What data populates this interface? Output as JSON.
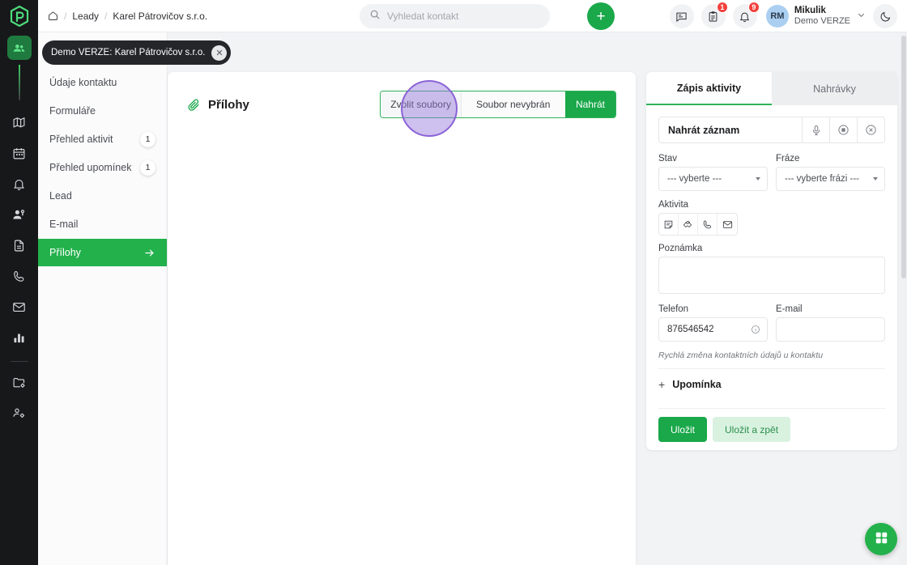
{
  "app": {
    "logo_icon": "hexagon-r-logo",
    "accent_green": "#1aa84a",
    "active_green": "#23b14c",
    "dark_rail": "#17181a",
    "cursor_highlight": "#8b63d6"
  },
  "rail": {
    "items": [
      {
        "icon": "contacts-icon",
        "name": "contacts",
        "active": true
      },
      {
        "icon": "map-icon",
        "name": "map",
        "active": false
      },
      {
        "icon": "calendar-icon",
        "name": "calendar",
        "active": false
      },
      {
        "icon": "bell-icon",
        "name": "notifications",
        "active": false
      },
      {
        "icon": "user-key-icon",
        "name": "user-access",
        "active": false
      },
      {
        "icon": "document-icon",
        "name": "documents",
        "active": false
      },
      {
        "icon": "phone-icon",
        "name": "calls",
        "active": false
      },
      {
        "icon": "envelope-icon",
        "name": "mail",
        "active": false
      },
      {
        "icon": "bar-chart-icon",
        "name": "statistics",
        "active": false
      },
      {
        "icon": "folder-settings-icon",
        "name": "folder-settings",
        "active": false
      },
      {
        "icon": "user-settings-icon",
        "name": "user-settings",
        "active": false
      }
    ]
  },
  "breadcrumb": {
    "home_icon": "home-icon",
    "separator": "/",
    "items": [
      "Leady",
      "Karel Pátrovičov s.r.o."
    ]
  },
  "search": {
    "icon": "search-icon",
    "placeholder": "Vyhledat kontakt",
    "value": ""
  },
  "topbar": {
    "add_label": "+",
    "icons": [
      {
        "name": "feed-icon",
        "badge": ""
      },
      {
        "name": "clipboard-icon",
        "badge": "1"
      },
      {
        "name": "bell-icon",
        "badge": "9"
      }
    ],
    "user": {
      "initials": "RM",
      "name": "Mikulik",
      "subtitle": "Demo VERZE",
      "chevron_icon": "chevron-down-icon"
    },
    "theme_toggle_icon": "moon-icon"
  },
  "demo_pill": {
    "label": "Demo VERZE: Karel Pátrovičov s.r.o.",
    "close_icon": "close-icon",
    "close_label": "✕"
  },
  "subnav": {
    "items": [
      {
        "label": "Údaje kontaktu",
        "badge": "",
        "active": false
      },
      {
        "label": "Formuláře",
        "badge": "",
        "active": false
      },
      {
        "label": "Přehled aktivit",
        "badge": "1",
        "active": false
      },
      {
        "label": "Přehled upomínek",
        "badge": "1",
        "active": false
      },
      {
        "label": "Lead",
        "badge": "",
        "active": false
      },
      {
        "label": "E-mail",
        "badge": "",
        "active": false
      },
      {
        "label": "Přílohy",
        "badge": "",
        "active": true,
        "arrow_icon": "arrow-right-icon"
      }
    ]
  },
  "main": {
    "title": "Přílohy",
    "title_icon": "paperclip-icon",
    "upload": {
      "choose_label": "Zvolit soubory",
      "file_status": "Soubor nevybrán",
      "upload_label": "Nahrát"
    }
  },
  "side": {
    "tabs": [
      {
        "label": "Zápis aktivity",
        "active": true
      },
      {
        "label": "Nahrávky",
        "active": false
      }
    ],
    "recorder": {
      "label": "Nahrát záznam",
      "buttons": [
        {
          "name": "microphone-icon"
        },
        {
          "name": "stop-record-icon"
        },
        {
          "name": "cancel-record-icon"
        }
      ]
    },
    "stav": {
      "label": "Stav",
      "value": "--- vyberte ---"
    },
    "fraze": {
      "label": "Fráze",
      "value": "--- vyberte frázi ---"
    },
    "aktivita": {
      "label": "Aktivita",
      "buttons": [
        {
          "name": "note-icon"
        },
        {
          "name": "handshake-icon"
        },
        {
          "name": "phone-icon"
        },
        {
          "name": "envelope-icon"
        }
      ]
    },
    "poznamka": {
      "label": "Poznámka",
      "value": "",
      "placeholder": ""
    },
    "telefon": {
      "label": "Telefon",
      "value": "876546542",
      "info_icon": "info-icon"
    },
    "email": {
      "label": "E-mail",
      "value": "",
      "placeholder": ""
    },
    "hint": "Rychlá změna kontaktních údajů u kontaktu",
    "reminder": {
      "label": "Upomínka",
      "plus": "+",
      "icon": "plus-icon"
    },
    "save": {
      "primary": "Uložit",
      "secondary": "Uložit a zpět"
    }
  },
  "fab": {
    "icon": "apps-grid-icon",
    "name": "apps-launcher"
  }
}
